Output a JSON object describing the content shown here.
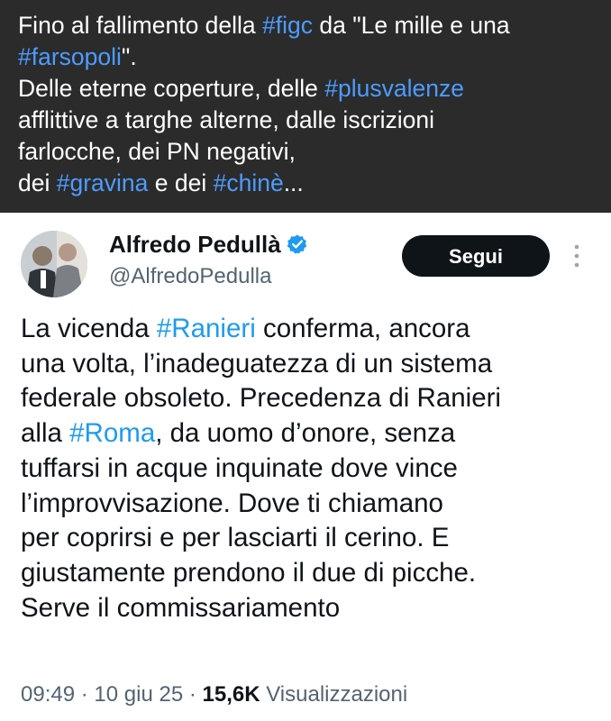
{
  "caption": {
    "lines": [
      [
        {
          "t": "Fino al fallimento della "
        },
        {
          "t": "#figc",
          "tag": true
        },
        {
          "t": " da \"Le mille e una"
        }
      ],
      [
        {
          "t": "#farsopoli",
          "tag": true
        },
        {
          "t": "\"."
        }
      ],
      [
        {
          "t": "Delle eterne coperture, delle "
        },
        {
          "t": "#plusvalenze",
          "tag": true
        }
      ],
      [
        {
          "t": "afflittive a targhe alterne, dalle iscrizioni"
        }
      ],
      [
        {
          "t": "farlocche, dei PN negativi,"
        }
      ],
      [
        {
          "t": "dei "
        },
        {
          "t": "#gravina",
          "tag": true
        },
        {
          "t": " e dei "
        },
        {
          "t": "#chinè",
          "tag": true
        },
        {
          "t": "..."
        }
      ]
    ]
  },
  "tweet": {
    "author_name": "Alfredo Pedullà",
    "author_handle": "@AlfredoPedulla",
    "verified_icon": "verified-badge-icon",
    "follow_label": "Segui",
    "more_icon": "more-vertical-icon",
    "body_lines": [
      [
        {
          "t": "La vicenda "
        },
        {
          "t": "#Ranieri",
          "tag": true
        },
        {
          "t": " conferma, ancora"
        }
      ],
      [
        {
          "t": "una volta, l’inadeguatezza di un sistema"
        }
      ],
      [
        {
          "t": "federale obsoleto. Precedenza di Ranieri"
        }
      ],
      [
        {
          "t": "alla "
        },
        {
          "t": "#Roma",
          "tag": true
        },
        {
          "t": ", da uomo d’onore, senza"
        }
      ],
      [
        {
          "t": "tuffarsi in acque inquinate dove vince"
        }
      ],
      [
        {
          "t": "l’improvvisazione. Dove ti chiamano"
        }
      ],
      [
        {
          "t": "per coprirsi e per lasciarti il cerino. E"
        }
      ],
      [
        {
          "t": "giustamente prendono il due di picche."
        }
      ],
      [
        {
          "t": "Serve il commissariamento"
        }
      ]
    ],
    "time": "09:49",
    "date": "10 giu 25",
    "views_count": "15,6K",
    "views_label": "Visualizzazioni",
    "separator": "·"
  },
  "colors": {
    "caption_bg": "#2b2b2b",
    "caption_tag": "#4d9cff",
    "hashtag": "#1d9bf0",
    "verified": "#1d9bf0",
    "follow_bg": "#0f1419",
    "muted": "#536471"
  }
}
